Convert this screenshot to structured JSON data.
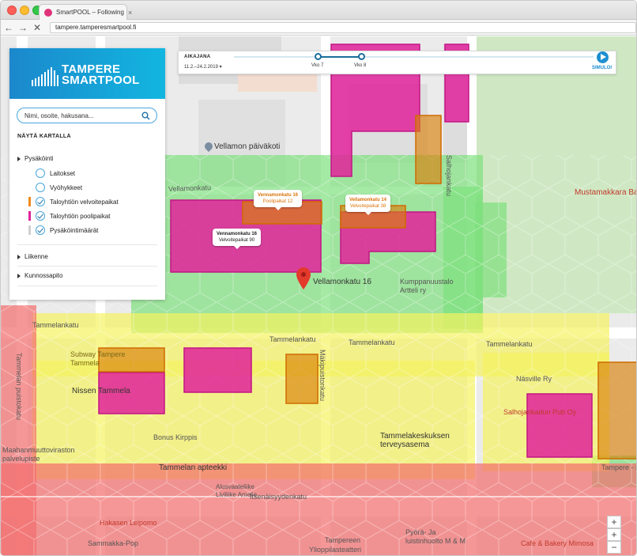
{
  "browser": {
    "tab_title": "SmartPOOL – Following",
    "tab_close": "×",
    "url": "tampere.tamperesmartpool.fi",
    "back_glyph": "←",
    "forward_glyph": "→",
    "reload_glyph": "✕"
  },
  "panel": {
    "logo_line1": "TAMPERE",
    "logo_line2": "SMARTPOOL",
    "search_placeholder": "Nimi, osoite, hakusana...",
    "show_title": "NÄYTÄ KARTALLA",
    "groups": [
      {
        "label": "Pysäköinti",
        "items": [
          {
            "label": "Laitokset",
            "checked": false
          },
          {
            "label": "Vyöhykkeet",
            "checked": false
          },
          {
            "label": "Taloyhtiön velvoitepaikat",
            "checked": true,
            "color": "#f08a1c"
          },
          {
            "label": "Taloyhtiön poolipaikat",
            "checked": true,
            "color": "#e0229a"
          },
          {
            "label": "Pysäköintimäärät",
            "checked": true,
            "color": "#d0d0d0"
          }
        ]
      },
      {
        "label": "Liikenne"
      },
      {
        "label": "Kunnossapito"
      }
    ]
  },
  "timeline": {
    "title": "AIKAJANA",
    "range": "11.2.–24.2.2019",
    "week1": "Vko 7",
    "week2": "Vko 8",
    "simulate": "SIMULOI"
  },
  "callouts": {
    "c1_title": "Vennamonkatu 16",
    "c1_sub": "Poolipaikat 12",
    "c2_title": "Vennamonkatu 16",
    "c2_sub": "Velvoitepaikat 90",
    "c3_title": "Vellamonkatu 14",
    "c3_sub": "Velvoitepaikat 38"
  },
  "map_labels": {
    "vellamon_paivakoti": "Vellamon päiväkoti",
    "vellamonkatu_road": "Vellamonkatu",
    "vellamonkatu16": "Vellamonkatu 16",
    "kumppanuustalo": "Kumppanuustalo\nArtteli ry",
    "mustamakkara": "Mustamakkara Ba",
    "tammelankatu1": "Tammelankatu",
    "tammelankatu2": "Tammelankatu",
    "tammelankatu3": "Tammelankatu",
    "tammelankatu4": "Tammelankatu",
    "subway": "Subway Tampere\nTammela",
    "nissen": "Nissen Tammela",
    "bonus": "Bonus Kirppis",
    "maahanmuutto": "Maahanmuuttoviraston\npalvelupiste",
    "apteekki": "Tammelan apteekki",
    "alusvaate": "Alusvaateliike\nLiviliike Amelie",
    "tammelakeskus": "Tammelakeskuksen\nterveysasema",
    "itsenaisyydenkatu": "Itsenäisyydenkatu",
    "hakasen": "Hakasen Leipomo",
    "sammakka": "Sammakka-Pop",
    "pyora": "Pyörä- Ja\nluistinhuolto M & M",
    "ylioppilas": "Ylioppilasteatteri",
    "tampereen": "Tampereen",
    "cafe_mimosa": "Cafe & Bakery Mimosa",
    "salhojankadun": "Salhojankadun Pub Oy",
    "naasville": "Näsville Ry",
    "tampere_k": "Tampere - K",
    "salhojankatu": "Salhojankatu",
    "makipuistonkatu": "Mäkipuistonkatu",
    "tammelan_puistokatu": "Tammelan puistokatu",
    "sammonkatu": "Ylioppilasteatteri"
  },
  "zoom": {
    "in": "+",
    "out": "−",
    "extra": "+"
  },
  "colors": {
    "brand_blue": "#1b88cc",
    "pool_magenta": "#e0229a",
    "obligation_orange": "#f08a1c",
    "hex_green": "#7de07d",
    "hex_yellow": "#f5f25f",
    "hex_red": "#f36f6f"
  }
}
